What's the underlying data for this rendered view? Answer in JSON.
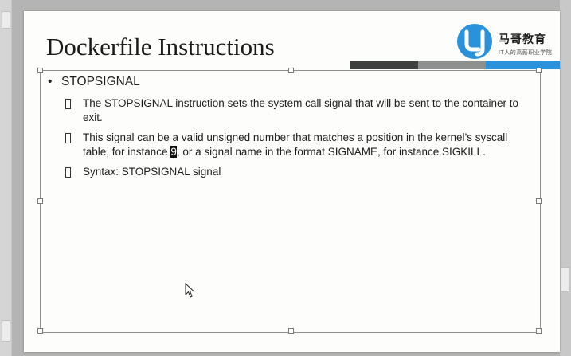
{
  "slide": {
    "title": "Dockerfile Instructions",
    "logo": {
      "name": "马哥教育",
      "slogan": "IT人的高薪职业学院",
      "colors": {
        "blue": "#2a92db"
      }
    },
    "header_bar_colors": [
      "#3e3f3f",
      "#8e8f8f",
      "#2a92db"
    ],
    "bullet": {
      "heading": "STOPSIGNAL",
      "items": [
        {
          "text": "The STOPSIGNAL instruction sets the system call signal that will be sent to the container to exit."
        },
        {
          "text_before": "This signal can be a valid unsigned number that matches a position in the kernel’s syscall table, for instance ",
          "highlight": "9",
          "text_after": ", or a signal name in the format SIGNAME, for instance SIGKILL."
        },
        {
          "text": "Syntax: STOPSIGNAL signal"
        }
      ]
    }
  },
  "icons": {
    "bullet": "bullet-dot-icon",
    "subbullet": "square-bullet-icon",
    "cursor": "mouse-cursor-icon"
  }
}
